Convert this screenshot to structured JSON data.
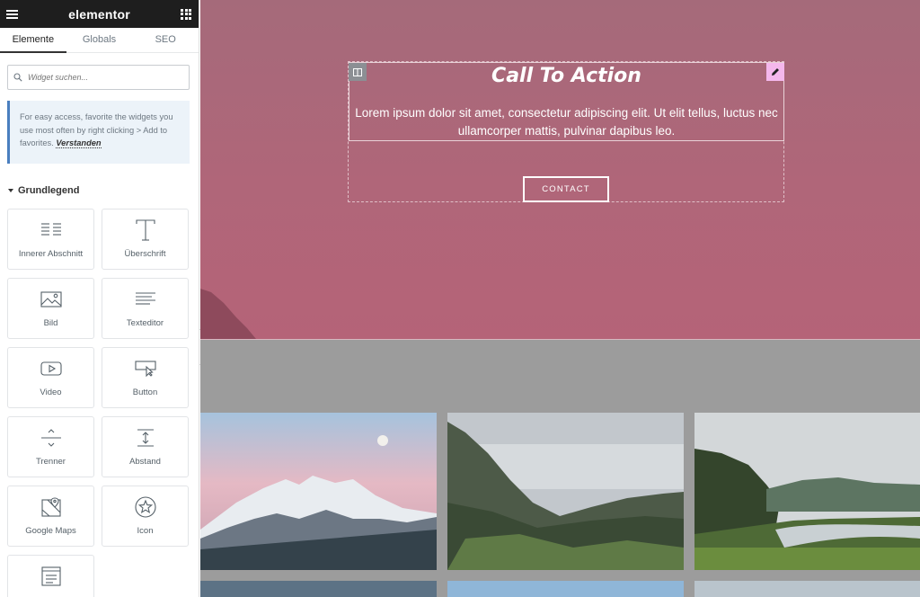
{
  "app": {
    "brand": "elementor"
  },
  "tabs": [
    {
      "label": "Elemente",
      "active": true
    },
    {
      "label": "Globals",
      "active": false
    },
    {
      "label": "SEO",
      "active": false
    }
  ],
  "search": {
    "placeholder": "Widget suchen..."
  },
  "hint": {
    "text": "For easy access, favorite the widgets you use most often by right clicking > Add to favorites.",
    "link": "Verstanden"
  },
  "category": {
    "label": "Grundlegend"
  },
  "widgets": [
    {
      "label": "Innerer Abschnitt",
      "icon": "inner-section-icon"
    },
    {
      "label": "Überschrift",
      "icon": "heading-icon"
    },
    {
      "label": "Bild",
      "icon": "image-icon"
    },
    {
      "label": "Texteditor",
      "icon": "text-editor-icon"
    },
    {
      "label": "Video",
      "icon": "video-icon"
    },
    {
      "label": "Button",
      "icon": "button-icon"
    },
    {
      "label": "Trenner",
      "icon": "divider-icon"
    },
    {
      "label": "Abstand",
      "icon": "spacer-icon"
    },
    {
      "label": "Google Maps",
      "icon": "google-maps-icon"
    },
    {
      "label": "Icon",
      "icon": "star-icon"
    },
    {
      "label": "",
      "icon": "list-icon"
    }
  ],
  "cta": {
    "title": "Call To Action",
    "text_line1": "Lorem ipsum dolor sit amet, consectetur adipiscing elit. Ut elit tellus, luctus nec",
    "text_line2": "ullamcorper mattis, pulvinar dapibus leo.",
    "button": "CONTACT"
  },
  "colors": {
    "hero": "#b06679",
    "gallery_bg": "#9c9c9c",
    "edit_handle": "#f4b7ec",
    "hint_border": "#4a7fbf"
  }
}
